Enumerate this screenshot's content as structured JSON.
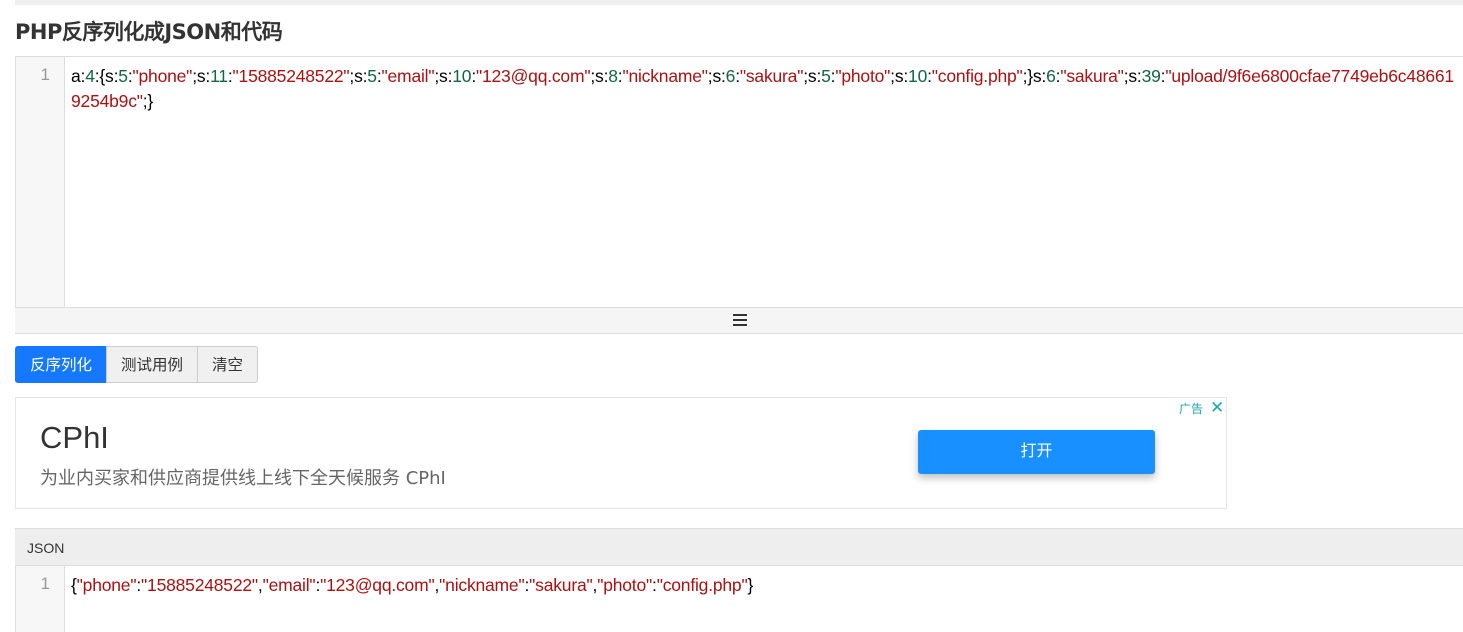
{
  "page_title": "PHP反序列化成JSON和代码",
  "input_editor": {
    "line_number": "1",
    "tokens": [
      {
        "t": "a:",
        "c": ""
      },
      {
        "t": "4",
        "c": "number"
      },
      {
        "t": ":{s:",
        "c": ""
      },
      {
        "t": "5",
        "c": "number"
      },
      {
        "t": ":",
        "c": ""
      },
      {
        "t": "\"phone\"",
        "c": "string"
      },
      {
        "t": ";s:",
        "c": ""
      },
      {
        "t": "11",
        "c": "number"
      },
      {
        "t": ":",
        "c": ""
      },
      {
        "t": "\"15885248522\"",
        "c": "string"
      },
      {
        "t": ";s:",
        "c": ""
      },
      {
        "t": "5",
        "c": "number"
      },
      {
        "t": ":",
        "c": ""
      },
      {
        "t": "\"email\"",
        "c": "string"
      },
      {
        "t": ";s:",
        "c": ""
      },
      {
        "t": "10",
        "c": "number"
      },
      {
        "t": ":",
        "c": ""
      },
      {
        "t": "\"123@qq.com\"",
        "c": "string"
      },
      {
        "t": ";s:",
        "c": ""
      },
      {
        "t": "8",
        "c": "number"
      },
      {
        "t": ":",
        "c": ""
      },
      {
        "t": "\"nickname\"",
        "c": "string"
      },
      {
        "t": ";s:",
        "c": ""
      },
      {
        "t": "6",
        "c": "number"
      },
      {
        "t": ":",
        "c": ""
      },
      {
        "t": "\"sakura\"",
        "c": "string"
      },
      {
        "t": ";s:",
        "c": ""
      },
      {
        "t": "5",
        "c": "number"
      },
      {
        "t": ":",
        "c": ""
      },
      {
        "t": "\"photo\"",
        "c": "string"
      },
      {
        "t": ";s:",
        "c": ""
      },
      {
        "t": "10",
        "c": "number"
      },
      {
        "t": ":",
        "c": ""
      },
      {
        "t": "\"config.php\"",
        "c": "string"
      },
      {
        "t": ";}s:",
        "c": ""
      },
      {
        "t": "6",
        "c": "number"
      },
      {
        "t": ":",
        "c": ""
      },
      {
        "t": "\"sakura\"",
        "c": "string"
      },
      {
        "t": ";s:",
        "c": ""
      },
      {
        "t": "39",
        "c": "number"
      },
      {
        "t": ":",
        "c": ""
      },
      {
        "t": "\"upload/9f6e6800cfae7749eb6c486619254b9c\"",
        "c": "string"
      },
      {
        "t": ";}",
        "c": ""
      }
    ]
  },
  "buttons": {
    "unserialize": "反序列化",
    "test_case": "测试用例",
    "clear": "清空"
  },
  "ad": {
    "title": "CPhI",
    "description": "为业内买家和供应商提供线上线下全天候服务 CPhI",
    "open_button": "打开",
    "label": "广告",
    "close_icon": "✕"
  },
  "json_output": {
    "header": "JSON",
    "line_number": "1",
    "tokens": [
      {
        "t": "{",
        "c": ""
      },
      {
        "t": "\"phone\"",
        "c": "string"
      },
      {
        "t": ":",
        "c": ""
      },
      {
        "t": "\"15885248522\"",
        "c": "string"
      },
      {
        "t": ",",
        "c": ""
      },
      {
        "t": "\"email\"",
        "c": "string"
      },
      {
        "t": ":",
        "c": ""
      },
      {
        "t": "\"123@qq.com\"",
        "c": "string"
      },
      {
        "t": ",",
        "c": ""
      },
      {
        "t": "\"nickname\"",
        "c": "string"
      },
      {
        "t": ":",
        "c": ""
      },
      {
        "t": "\"sakura\"",
        "c": "string"
      },
      {
        "t": ",",
        "c": ""
      },
      {
        "t": "\"photo\"",
        "c": "string"
      },
      {
        "t": ":",
        "c": ""
      },
      {
        "t": "\"config.php\"",
        "c": "string"
      },
      {
        "t": "}",
        "c": ""
      }
    ]
  },
  "colors": {
    "primary": "#1677ff",
    "ad_button": "#1890ff",
    "code_string": "#aa1111",
    "code_number": "#116644",
    "ad_label": "#1fa8a8"
  }
}
